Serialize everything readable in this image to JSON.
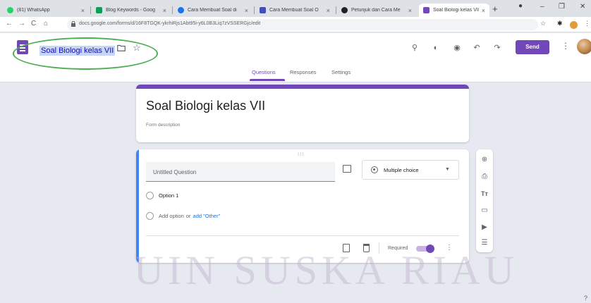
{
  "browser": {
    "tabs": [
      {
        "title": "(81) WhatsApp",
        "color": "#25d366",
        "active": false
      },
      {
        "title": "Blog Keywords - Goog",
        "color": "#0f9d58",
        "active": false
      },
      {
        "title": "Cara Membuat Soal di",
        "color": "#1a73e8",
        "active": false
      },
      {
        "title": "Cara Membuat Soal O",
        "color": "#3f51b5",
        "active": false
      },
      {
        "title": "Petunjuk dan Cara Me",
        "color": "#202124",
        "active": false
      },
      {
        "title": "Soal Biologi kelas VII",
        "color": "#7248b9",
        "active": true
      }
    ],
    "url": "docs.google.com/forms/d/16F8TGQK-ykrhiRjs1Abt95i-y6L0B3Liq7zVSSERGjc/edit"
  },
  "header": {
    "doc_title": "Soal Biologi kelas VII",
    "send_label": "Send",
    "tabs": [
      "Questions",
      "Responses",
      "Settings"
    ],
    "active_tab": "Questions",
    "accent_color": "#7248b9"
  },
  "form": {
    "title": "Soal Biologi kelas VII",
    "description_placeholder": "Form description"
  },
  "question": {
    "title_placeholder": "Untitled Question",
    "type": "Multiple choice",
    "options": [
      "Option 1"
    ],
    "add_option_label": "Add option",
    "or_label": "or",
    "add_other_label": "add \"Other\"",
    "required_label": "Required",
    "required": true
  },
  "watermark": "UIN SUSKA RIAU"
}
